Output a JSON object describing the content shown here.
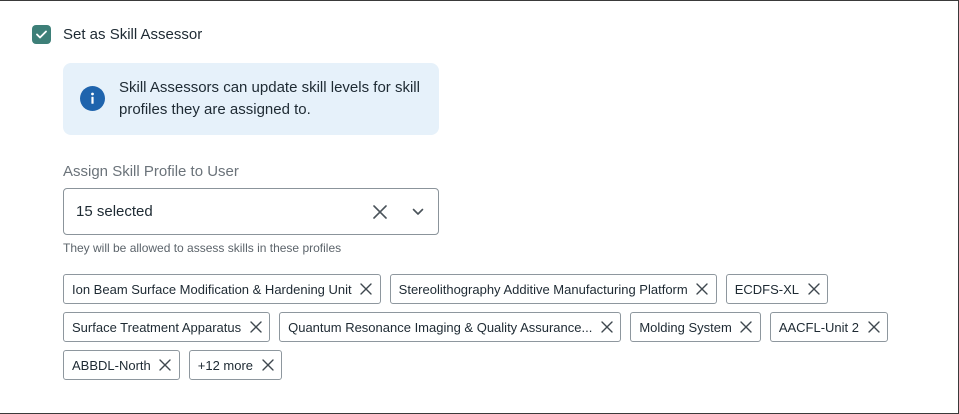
{
  "assessor": {
    "checkbox_label": "Set as Skill Assessor",
    "checked": true,
    "accent_color": "#3d7f78"
  },
  "info": {
    "icon": "info-icon",
    "text": "Skill Assessors can update skill levels for skill profiles they are assigned to."
  },
  "skill_profile": {
    "label": "Assign Skill Profile to User",
    "selected_text": "15 selected",
    "helper": "They will be allowed to assess skills in these profiles",
    "chips": [
      {
        "label": "Ion Beam Surface Modification & Hardening Unit"
      },
      {
        "label": "Stereolithography Additive Manufacturing Platform"
      },
      {
        "label": "ECDFS-XL"
      },
      {
        "label": "Surface Treatment Apparatus"
      },
      {
        "label": "Quantum Resonance Imaging & Quality Assurance..."
      },
      {
        "label": "Molding System"
      },
      {
        "label": "AACFL-Unit 2"
      },
      {
        "label": "ABBDL-North"
      },
      {
        "label": "+12 more"
      }
    ]
  }
}
